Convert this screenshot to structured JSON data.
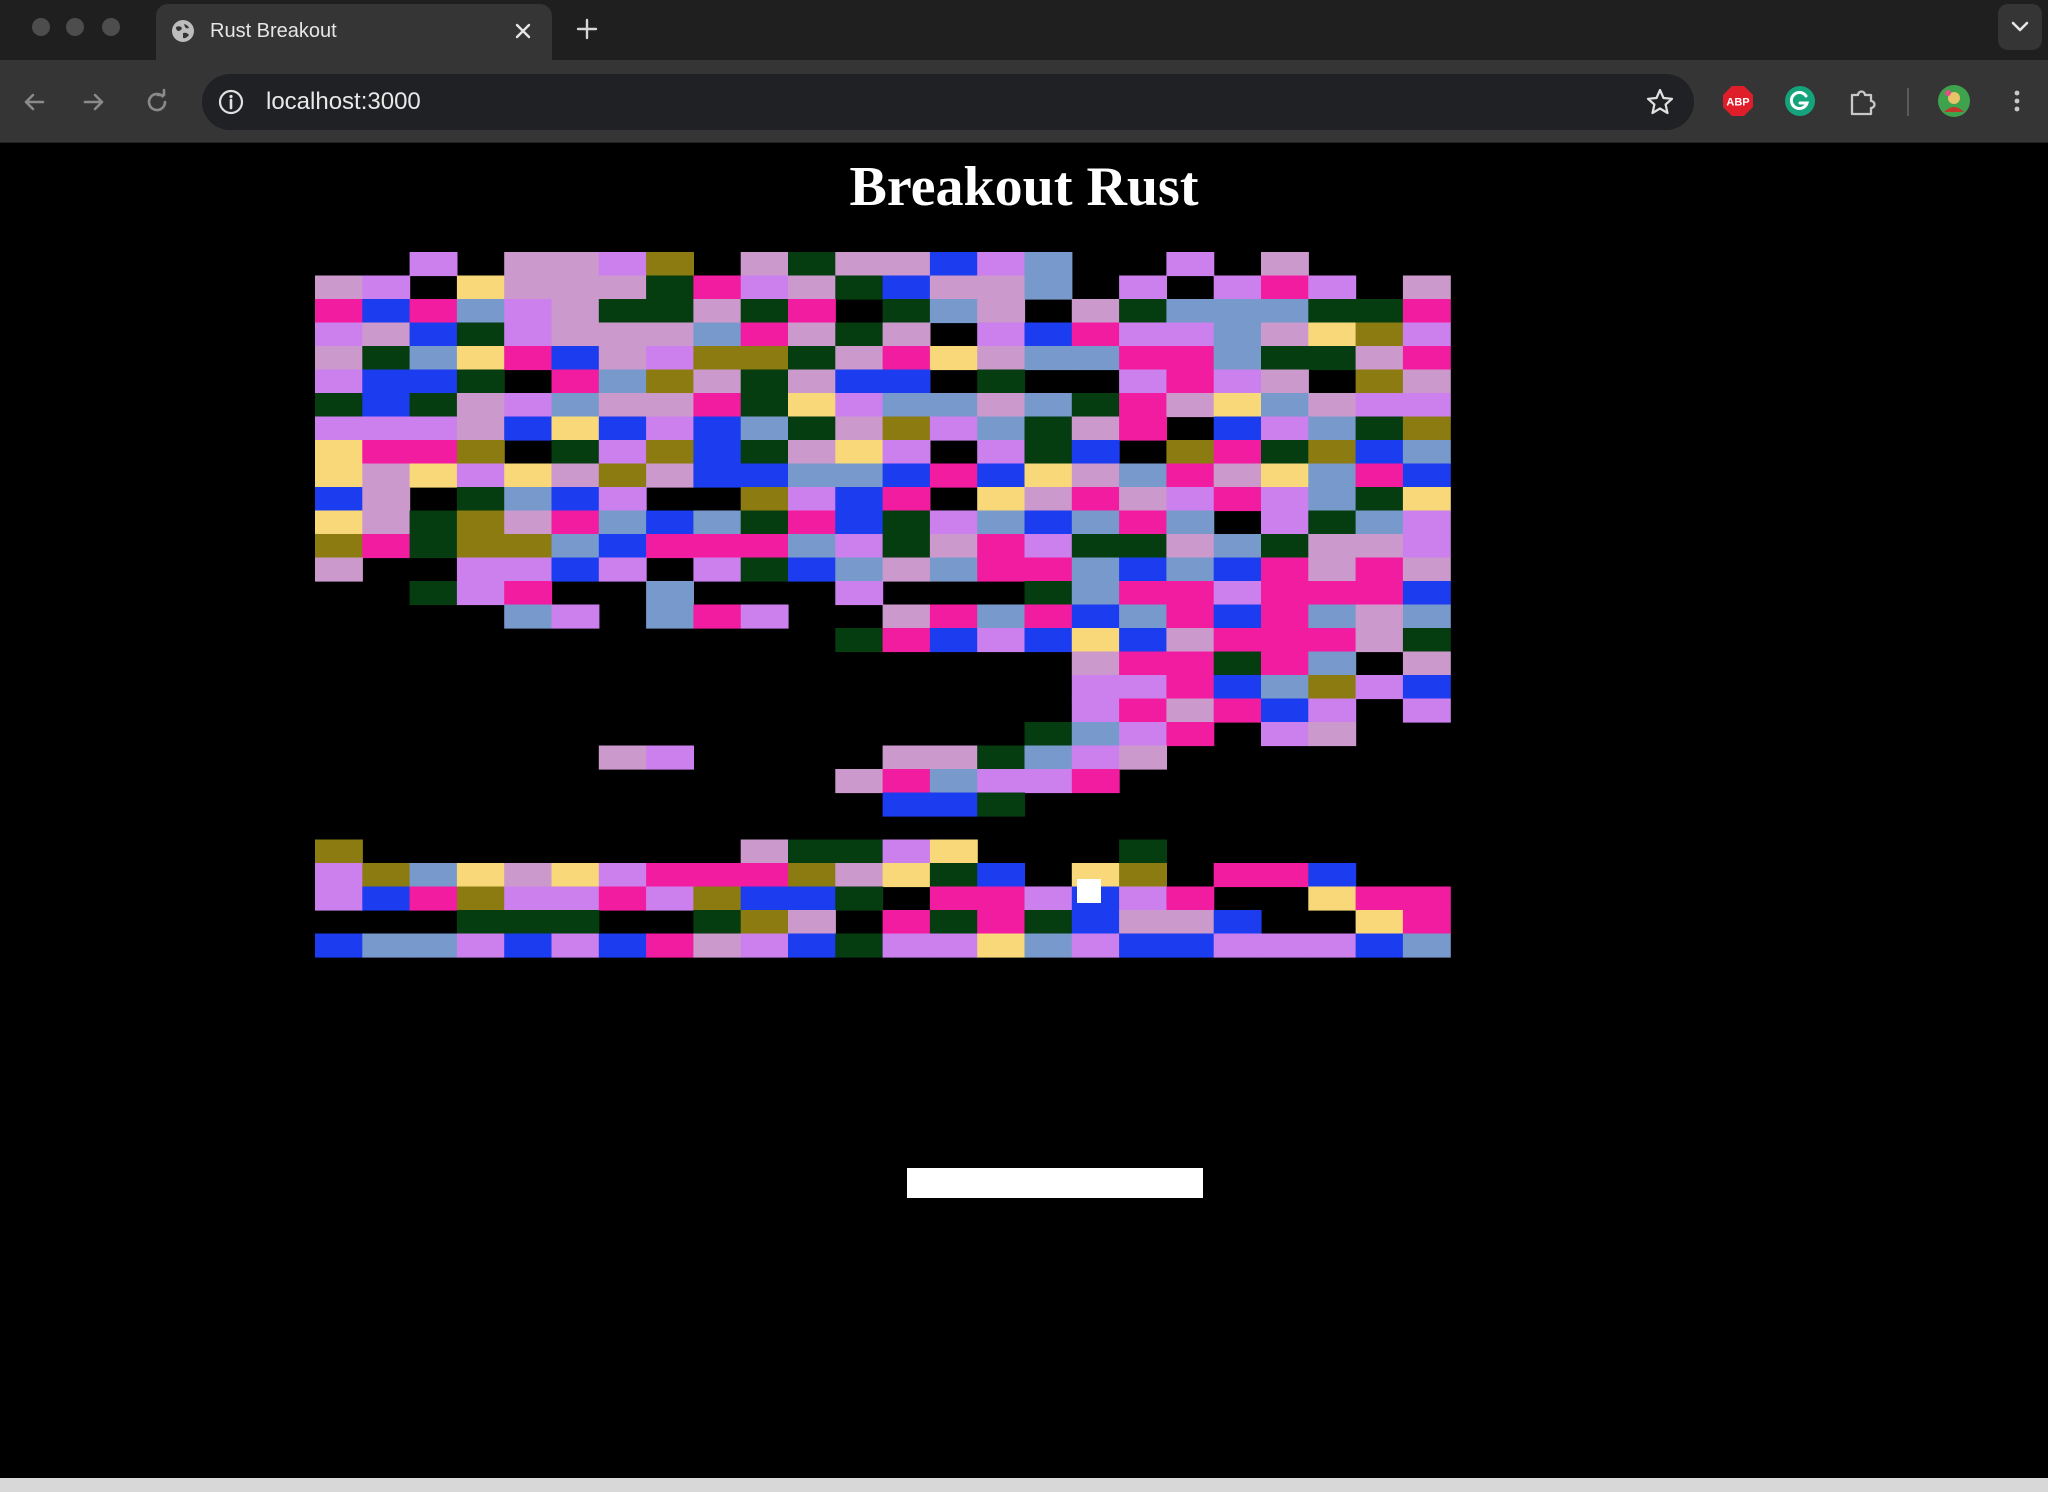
{
  "browser": {
    "tab_title": "Rust Breakout",
    "url": "localhost:3000",
    "icons": {
      "traffic_lights": [
        "close-light",
        "minimize-light",
        "zoom-light"
      ],
      "tab_favicon": "globe-icon",
      "tab_close": "close-icon",
      "new_tab": "plus-icon",
      "tab_menu": "chevron-down-icon",
      "nav": [
        "back-arrow-icon",
        "forward-arrow-icon",
        "reload-icon"
      ],
      "site_info": "info-icon",
      "bookmark": "star-icon",
      "extensions": [
        "adblock-plus-icon",
        "grammarly-icon",
        "puzzle-extensions-icon"
      ],
      "profile": "profile-avatar",
      "menu": "kebab-menu-icon"
    }
  },
  "game": {
    "title": "Breakout Rust",
    "background": "#000000",
    "brick_colors": {
      "l": "#cc99cc",
      "v": "#cc80ee",
      "s": "#7799cc",
      "y": "#f8d878",
      "o": "#8b7b10",
      "g": "#053d10",
      "p": "#f21ca0",
      "b": "#1c3cf0"
    },
    "brick_grid": [
      "..v.llvo.lgllbvs..v.l...",
      "lv.ylllgpvlgblls.v.vpv.l",
      "pbpsvlgglgp.gsl.lgsssggp",
      "vlbgvlllsplgl.vbpvvslyov",
      "lgsypblvooglpylssppsgglp",
      "vbbg.psolglbb.g..vpvl.ol",
      "gbglvsllpgyvsslsgplyslvv",
      "vvvlbybvbsglovsglp.bvsgo",
      "yppo.gvobglyv.vgb.opgobs",
      "ylyvylolbbssbpbylsplyspb",
      "bl.gsbv..ovbp.ylplvpvsgy",
      "ylgolpsbsgpbgvsbsps.vgsv",
      "opgoosbpppsvglpvgglsgllv",
      "l..vvbv.vgbslsppsbsbplpl",
      "..gvp..s...v...gsppvpppb",
      "....sv.spv..lpspbspbpsls",
      "...........gpbvbyblppplg",
      "................lppgps.l",
      "................vvpbsovb",
      "................vplpbv.v",
      "...............gsvp.vl..",
      "......lv....llgsvl......",
      "...........lpsvvp.......",
      "............bbg.........",
      "........................",
      "o........lggvy...g......",
      "vosylyvpppolygb.yo.ppb..",
      "vbpovvpvobbg.ppvbvp..ypp",
      "...ggg..gol.pgpgbllb..yp",
      "bssvbvbplvbgvvysvbbvvvbs"
    ],
    "ball_color": "#ffffff",
    "paddle_color": "#ffffff"
  }
}
